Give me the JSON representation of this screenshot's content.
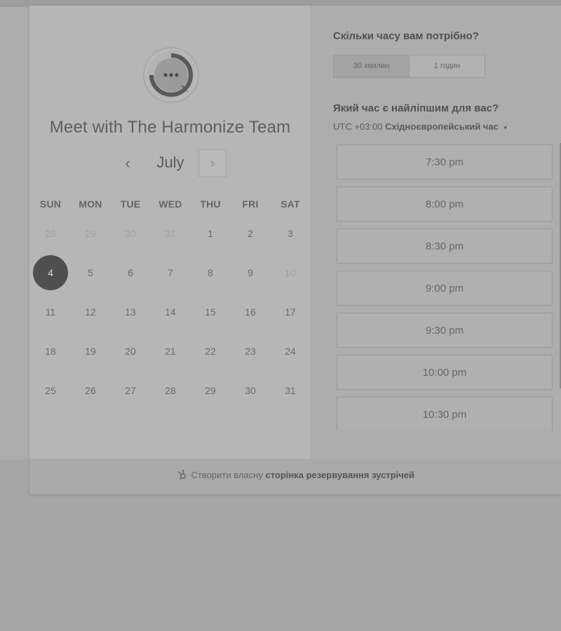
{
  "left": {
    "title": "Meet with The Harmonize Team",
    "month": "July",
    "prev_glyph": "‹",
    "next_glyph": "›",
    "weekdays": [
      "SUN",
      "MON",
      "TUE",
      "WED",
      "THU",
      "FRI",
      "SAT"
    ],
    "weeks": [
      [
        {
          "d": "28",
          "muted": true
        },
        {
          "d": "29",
          "muted": true
        },
        {
          "d": "30",
          "muted": true
        },
        {
          "d": "31",
          "muted": true
        },
        {
          "d": "1"
        },
        {
          "d": "2"
        },
        {
          "d": "3"
        }
      ],
      [
        {
          "d": "4",
          "selected": true
        },
        {
          "d": "5"
        },
        {
          "d": "6"
        },
        {
          "d": "7"
        },
        {
          "d": "8"
        },
        {
          "d": "9"
        },
        {
          "d": "10",
          "muted": true
        }
      ],
      [
        {
          "d": "11"
        },
        {
          "d": "12"
        },
        {
          "d": "13"
        },
        {
          "d": "14"
        },
        {
          "d": "15"
        },
        {
          "d": "16"
        },
        {
          "d": "17"
        }
      ],
      [
        {
          "d": "18"
        },
        {
          "d": "19"
        },
        {
          "d": "20"
        },
        {
          "d": "21"
        },
        {
          "d": "22"
        },
        {
          "d": "23"
        },
        {
          "d": "24"
        }
      ],
      [
        {
          "d": "25"
        },
        {
          "d": "26"
        },
        {
          "d": "27"
        },
        {
          "d": "28"
        },
        {
          "d": "29"
        },
        {
          "d": "30"
        },
        {
          "d": "31"
        }
      ]
    ]
  },
  "right": {
    "duration_question": "Скільки часу вам потрібно?",
    "duration_options": [
      "30 хвилин",
      "1 годин"
    ],
    "time_question": "Який час є найліпшим для вас?",
    "tz_offset": "UTC +03:00",
    "tz_name": "Східноєвропейський час",
    "tz_caret": "▾",
    "slots": [
      "7:30 pm",
      "8:00 pm",
      "8:30 pm",
      "9:00 pm",
      "9:30 pm",
      "10:00 pm",
      "10:30 pm"
    ]
  },
  "footer": {
    "prefix": "Створити власну",
    "link": "сторінка резервування зустрічей"
  },
  "colors": {
    "selected_day": "#4f4f4f",
    "panel_left": "#b6b6b6",
    "panel_right": "#adadad"
  },
  "icons": {
    "logo": "chat-bubble-logo",
    "footer": "hubspot-sprocket-icon"
  }
}
